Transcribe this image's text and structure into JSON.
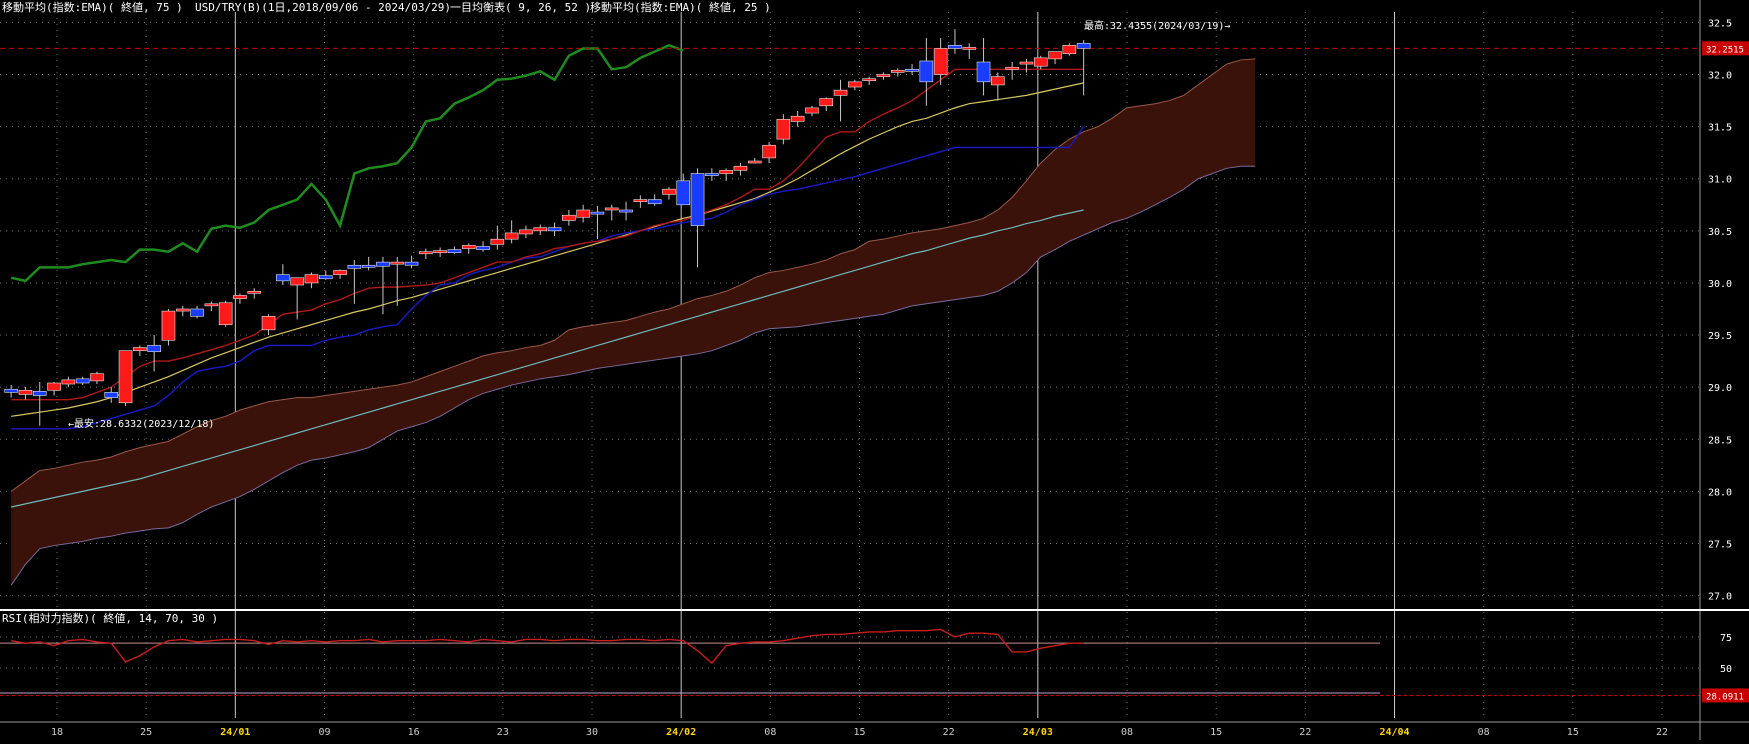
{
  "header": {
    "ema75_label": "移動平均(指数:EMA)( 終値, 75 )",
    "symbol_label": "USD/TRY(B)(1日,2018/09/06 - 2024/03/29)",
    "ichimoku_label": "一目均衡表( 9, 26, 52 )",
    "ema25_label": "移動平均(指数:EMA)( 終値, 25 )"
  },
  "colors": {
    "background": "#000000",
    "grid": "#6f6f6f",
    "separator": "#c8c8c8",
    "bull_candle": "#ff1a1a",
    "bear_candle": "#1a3cff",
    "tenkan": "#b01818",
    "kijun": "#1a1ac8",
    "chikou": "#1f8c1f",
    "senkou_a": "#9a5a4a",
    "senkou_b": "#7a6a9a",
    "cloud_fill": "#3a120a",
    "ema25": "#d9c860",
    "ema75": "#6fb8b8",
    "rsi_line": "#c81e1e",
    "price_marker": "#c80000"
  },
  "chart_data": [
    {
      "type": "candlestick",
      "ylim": [
        26.9,
        32.6
      ],
      "y_ticks": [
        "32.5",
        "32.0",
        "31.5",
        "31.0",
        "30.5",
        "30.0",
        "29.5",
        "29.0",
        "28.5",
        "28.0",
        "27.5",
        "27.0"
      ],
      "x_tick_labels": [
        "18",
        "25",
        "24/01",
        "09",
        "16",
        "23",
        "30",
        "24/02",
        "08",
        "15",
        "22",
        "24/03",
        "08",
        "15",
        "22",
        "24/04",
        "08",
        "15",
        "22"
      ],
      "x_tick_highlight": [
        "24/01",
        "24/02",
        "24/03",
        "24/04"
      ],
      "current_price": 32.2515,
      "current_price_label": "32.2515",
      "high_annotation": "最高:32.4355(2024/03/19)→",
      "low_annotation": "←最安:28.6332(2023/12/18)",
      "candles": [
        {
          "o": 28.98,
          "h": 29.02,
          "l": 28.9,
          "c": 28.95
        },
        {
          "o": 28.93,
          "h": 29.0,
          "l": 28.88,
          "c": 28.97
        },
        {
          "o": 28.96,
          "h": 29.05,
          "l": 28.63,
          "c": 28.92
        },
        {
          "o": 28.97,
          "h": 29.05,
          "l": 28.92,
          "c": 29.04
        },
        {
          "o": 29.03,
          "h": 29.1,
          "l": 29.0,
          "c": 29.07
        },
        {
          "o": 29.08,
          "h": 29.1,
          "l": 29.02,
          "c": 29.04
        },
        {
          "o": 29.06,
          "h": 29.15,
          "l": 29.03,
          "c": 29.13
        },
        {
          "o": 28.95,
          "h": 29.0,
          "l": 28.85,
          "c": 28.9
        },
        {
          "o": 28.85,
          "h": 29.35,
          "l": 28.82,
          "c": 29.35
        },
        {
          "o": 29.35,
          "h": 29.4,
          "l": 29.3,
          "c": 29.38
        },
        {
          "o": 29.4,
          "h": 29.5,
          "l": 29.15,
          "c": 29.34
        },
        {
          "o": 29.45,
          "h": 29.75,
          "l": 29.4,
          "c": 29.73
        },
        {
          "o": 29.73,
          "h": 29.78,
          "l": 29.68,
          "c": 29.75
        },
        {
          "o": 29.75,
          "h": 29.78,
          "l": 29.66,
          "c": 29.68
        },
        {
          "o": 29.78,
          "h": 29.82,
          "l": 29.73,
          "c": 29.8
        },
        {
          "o": 29.6,
          "h": 29.83,
          "l": 29.58,
          "c": 29.81
        },
        {
          "o": 29.85,
          "h": 29.9,
          "l": 29.8,
          "c": 29.88
        },
        {
          "o": 29.9,
          "h": 29.95,
          "l": 29.85,
          "c": 29.92
        },
        {
          "o": 29.55,
          "h": 29.7,
          "l": 29.5,
          "c": 29.68
        },
        {
          "o": 30.08,
          "h": 30.18,
          "l": 29.98,
          "c": 30.02
        },
        {
          "o": 29.98,
          "h": 30.05,
          "l": 29.65,
          "c": 30.05
        },
        {
          "o": 30.0,
          "h": 30.1,
          "l": 29.95,
          "c": 30.08
        },
        {
          "o": 30.07,
          "h": 30.12,
          "l": 30.03,
          "c": 30.04
        },
        {
          "o": 30.08,
          "h": 30.13,
          "l": 30.04,
          "c": 30.12
        },
        {
          "o": 30.17,
          "h": 30.22,
          "l": 29.8,
          "c": 30.14
        },
        {
          "o": 30.17,
          "h": 30.25,
          "l": 30.12,
          "c": 30.15
        },
        {
          "o": 30.2,
          "h": 30.25,
          "l": 29.7,
          "c": 30.16
        },
        {
          "o": 30.18,
          "h": 30.25,
          "l": 29.78,
          "c": 30.2
        },
        {
          "o": 30.2,
          "h": 30.26,
          "l": 30.14,
          "c": 30.17
        },
        {
          "o": 30.28,
          "h": 30.33,
          "l": 30.23,
          "c": 30.3
        },
        {
          "o": 30.29,
          "h": 30.34,
          "l": 30.25,
          "c": 30.31
        },
        {
          "o": 30.32,
          "h": 30.35,
          "l": 30.28,
          "c": 30.29
        },
        {
          "o": 30.33,
          "h": 30.38,
          "l": 30.28,
          "c": 30.36
        },
        {
          "o": 30.35,
          "h": 30.4,
          "l": 30.3,
          "c": 30.32
        },
        {
          "o": 30.37,
          "h": 30.55,
          "l": 30.32,
          "c": 30.42
        },
        {
          "o": 30.42,
          "h": 30.6,
          "l": 30.38,
          "c": 30.48
        },
        {
          "o": 30.47,
          "h": 30.55,
          "l": 30.43,
          "c": 30.51
        },
        {
          "o": 30.5,
          "h": 30.56,
          "l": 30.46,
          "c": 30.53
        },
        {
          "o": 30.53,
          "h": 30.58,
          "l": 30.45,
          "c": 30.5
        },
        {
          "o": 30.6,
          "h": 30.7,
          "l": 30.55,
          "c": 30.65
        },
        {
          "o": 30.63,
          "h": 30.75,
          "l": 30.58,
          "c": 30.7
        },
        {
          "o": 30.68,
          "h": 30.74,
          "l": 30.42,
          "c": 30.66
        },
        {
          "o": 30.7,
          "h": 30.75,
          "l": 30.6,
          "c": 30.72
        },
        {
          "o": 30.7,
          "h": 30.78,
          "l": 30.6,
          "c": 30.68
        },
        {
          "o": 30.78,
          "h": 30.84,
          "l": 30.72,
          "c": 30.8
        },
        {
          "o": 30.8,
          "h": 30.85,
          "l": 30.74,
          "c": 30.76
        },
        {
          "o": 30.85,
          "h": 30.92,
          "l": 30.8,
          "c": 30.9
        },
        {
          "o": 30.98,
          "h": 31.05,
          "l": 30.78,
          "c": 30.75
        },
        {
          "o": 31.05,
          "h": 31.1,
          "l": 30.15,
          "c": 30.55
        },
        {
          "o": 31.05,
          "h": 31.1,
          "l": 30.98,
          "c": 31.03
        },
        {
          "o": 31.05,
          "h": 31.1,
          "l": 30.98,
          "c": 31.08
        },
        {
          "o": 31.08,
          "h": 31.15,
          "l": 31.03,
          "c": 31.12
        },
        {
          "o": 31.17,
          "h": 31.2,
          "l": 31.15,
          "c": 31.17
        },
        {
          "o": 31.2,
          "h": 31.35,
          "l": 31.15,
          "c": 31.32
        },
        {
          "o": 31.38,
          "h": 31.62,
          "l": 31.33,
          "c": 31.57
        },
        {
          "o": 31.55,
          "h": 31.65,
          "l": 31.5,
          "c": 31.6
        },
        {
          "o": 31.63,
          "h": 31.7,
          "l": 31.6,
          "c": 31.68
        },
        {
          "o": 31.7,
          "h": 31.78,
          "l": 31.65,
          "c": 31.77
        },
        {
          "o": 31.8,
          "h": 31.95,
          "l": 31.55,
          "c": 31.85
        },
        {
          "o": 31.88,
          "h": 31.95,
          "l": 31.85,
          "c": 31.93
        },
        {
          "o": 31.95,
          "h": 31.98,
          "l": 31.9,
          "c": 31.96
        },
        {
          "o": 31.98,
          "h": 32.02,
          "l": 31.95,
          "c": 32.0
        },
        {
          "o": 32.02,
          "h": 32.06,
          "l": 31.98,
          "c": 32.04
        },
        {
          "o": 32.05,
          "h": 32.1,
          "l": 32.0,
          "c": 32.03
        },
        {
          "o": 32.13,
          "h": 32.35,
          "l": 31.7,
          "c": 31.93
        },
        {
          "o": 32.0,
          "h": 32.35,
          "l": 31.9,
          "c": 32.25
        },
        {
          "o": 32.28,
          "h": 32.4355,
          "l": 32.2,
          "c": 32.25
        },
        {
          "o": 32.25,
          "h": 32.3,
          "l": 32.15,
          "c": 32.26
        },
        {
          "o": 32.12,
          "h": 32.35,
          "l": 31.8,
          "c": 31.93
        },
        {
          "o": 31.9,
          "h": 32.02,
          "l": 31.75,
          "c": 31.98
        },
        {
          "o": 32.05,
          "h": 32.12,
          "l": 31.95,
          "c": 32.07
        },
        {
          "o": 32.1,
          "h": 32.15,
          "l": 32.02,
          "c": 32.12
        },
        {
          "o": 32.08,
          "h": 32.18,
          "l": 32.05,
          "c": 32.16
        },
        {
          "o": 32.15,
          "h": 32.2,
          "l": 32.1,
          "c": 32.22
        },
        {
          "o": 32.2,
          "h": 32.3,
          "l": 32.18,
          "c": 32.28
        },
        {
          "o": 32.3,
          "h": 32.33,
          "l": 31.8,
          "c": 32.2515
        }
      ],
      "ema25": [
        28.72,
        28.74,
        28.76,
        28.78,
        28.8,
        28.83,
        28.86,
        28.9,
        28.95,
        29.0,
        29.05,
        29.1,
        29.16,
        29.22,
        29.28,
        29.33,
        29.38,
        29.43,
        29.48,
        29.52,
        29.56,
        29.6,
        29.64,
        29.68,
        29.72,
        29.75,
        29.79,
        29.83,
        29.86,
        29.9,
        29.94,
        29.98,
        30.02,
        30.06,
        30.1,
        30.14,
        30.18,
        30.22,
        30.26,
        30.3,
        30.34,
        30.38,
        30.42,
        30.46,
        30.5,
        30.54,
        30.58,
        30.62,
        30.65,
        30.69,
        30.73,
        30.77,
        30.81,
        30.87,
        30.93,
        31.0,
        31.08,
        31.16,
        31.24,
        31.31,
        31.38,
        31.44,
        31.5,
        31.55,
        31.58,
        31.63,
        31.68,
        31.72,
        31.74,
        31.76,
        31.78,
        31.8,
        31.83,
        31.86,
        31.89,
        31.92
      ],
      "ema75": [
        27.85,
        27.88,
        27.91,
        27.94,
        27.97,
        28.0,
        28.03,
        28.06,
        28.09,
        28.12,
        28.16,
        28.2,
        28.24,
        28.28,
        28.32,
        28.36,
        28.4,
        28.44,
        28.48,
        28.52,
        28.56,
        28.6,
        28.64,
        28.68,
        28.72,
        28.76,
        28.8,
        28.84,
        28.88,
        28.92,
        28.96,
        29.0,
        29.04,
        29.08,
        29.12,
        29.16,
        29.2,
        29.24,
        29.28,
        29.32,
        29.36,
        29.4,
        29.44,
        29.48,
        29.52,
        29.56,
        29.6,
        29.64,
        29.68,
        29.72,
        29.76,
        29.8,
        29.84,
        29.88,
        29.92,
        29.96,
        30.0,
        30.04,
        30.08,
        30.12,
        30.16,
        30.2,
        30.24,
        30.28,
        30.31,
        30.35,
        30.39,
        30.43,
        30.46,
        30.5,
        30.53,
        30.57,
        30.6,
        30.64,
        30.67,
        30.7
      ],
      "tenkan": [
        28.88,
        28.88,
        28.88,
        28.88,
        28.88,
        28.9,
        28.95,
        29.0,
        29.1,
        29.2,
        29.25,
        29.25,
        29.28,
        29.32,
        29.36,
        29.4,
        29.45,
        29.5,
        29.6,
        29.7,
        29.72,
        29.74,
        29.8,
        29.84,
        29.9,
        29.95,
        29.96,
        29.96,
        29.97,
        29.98,
        30.0,
        30.05,
        30.1,
        30.15,
        30.2,
        30.2,
        30.25,
        30.28,
        30.33,
        30.35,
        30.38,
        30.4,
        30.42,
        30.45,
        30.5,
        30.55,
        30.58,
        30.6,
        30.65,
        30.7,
        30.75,
        30.82,
        30.9,
        30.9,
        30.98,
        31.1,
        31.25,
        31.4,
        31.45,
        31.45,
        31.55,
        31.62,
        31.68,
        31.75,
        31.85,
        31.95,
        32.05,
        32.05,
        32.05,
        32.05,
        32.05,
        32.05,
        32.05,
        32.05,
        32.05,
        32.05
      ],
      "kijun": [
        28.6,
        28.6,
        28.6,
        28.6,
        28.6,
        28.62,
        28.66,
        28.7,
        28.74,
        28.78,
        28.82,
        28.92,
        29.05,
        29.15,
        29.18,
        29.2,
        29.25,
        29.35,
        29.4,
        29.4,
        29.4,
        29.4,
        29.45,
        29.48,
        29.5,
        29.55,
        29.58,
        29.6,
        29.75,
        29.88,
        29.98,
        30.0,
        30.08,
        30.12,
        30.15,
        30.2,
        30.24,
        30.25,
        30.3,
        30.35,
        30.38,
        30.4,
        30.45,
        30.48,
        30.5,
        30.52,
        30.55,
        30.58,
        30.6,
        30.62,
        30.68,
        30.75,
        30.8,
        30.85,
        30.88,
        30.9,
        30.93,
        30.96,
        30.99,
        31.02,
        31.06,
        31.1,
        31.14,
        31.18,
        31.22,
        31.26,
        31.3,
        31.3,
        31.3,
        31.3,
        31.3,
        31.3,
        31.3,
        31.3,
        31.3,
        31.5
      ],
      "senkou_a": [
        28.0,
        28.1,
        28.2,
        28.22,
        28.25,
        28.28,
        28.3,
        28.33,
        28.38,
        28.42,
        28.45,
        28.48,
        28.55,
        28.62,
        28.68,
        28.72,
        28.78,
        28.82,
        28.86,
        28.88,
        28.9,
        28.9,
        28.92,
        28.94,
        28.96,
        28.98,
        29.0,
        29.02,
        29.05,
        29.1,
        29.15,
        29.2,
        29.25,
        29.3,
        29.33,
        29.35,
        29.38,
        29.4,
        29.45,
        29.55,
        29.58,
        29.6,
        29.62,
        29.64,
        29.68,
        29.72,
        29.75,
        29.8,
        29.85,
        29.88,
        29.92,
        29.98,
        30.05,
        30.1,
        30.12,
        30.15,
        30.18,
        30.22,
        30.28,
        30.32,
        30.4,
        30.42,
        30.45,
        30.48,
        30.5,
        30.52,
        30.55,
        30.58,
        30.62,
        30.7,
        30.82,
        30.98,
        31.15,
        31.28,
        31.38,
        31.45,
        31.5,
        31.58,
        31.68,
        31.7,
        31.72,
        31.75,
        31.8,
        31.9,
        32.0,
        32.1,
        32.14,
        32.15
      ],
      "senkou_b": [
        27.1,
        27.3,
        27.45,
        27.48,
        27.5,
        27.52,
        27.55,
        27.57,
        27.6,
        27.62,
        27.64,
        27.65,
        27.7,
        27.78,
        27.85,
        27.9,
        27.95,
        28.02,
        28.1,
        28.18,
        28.25,
        28.3,
        28.32,
        28.35,
        28.38,
        28.42,
        28.5,
        28.58,
        28.62,
        28.66,
        28.72,
        28.8,
        28.88,
        28.94,
        28.98,
        29.02,
        29.05,
        29.08,
        29.1,
        29.12,
        29.15,
        29.18,
        29.2,
        29.22,
        29.24,
        29.26,
        29.28,
        29.3,
        29.32,
        29.35,
        29.4,
        29.45,
        29.52,
        29.56,
        29.57,
        29.58,
        29.6,
        29.62,
        29.64,
        29.66,
        29.68,
        29.7,
        29.74,
        29.78,
        29.8,
        29.82,
        29.84,
        29.86,
        29.88,
        29.92,
        30.0,
        30.1,
        30.25,
        30.32,
        30.4,
        30.46,
        30.52,
        30.58,
        30.62,
        30.68,
        30.75,
        30.82,
        30.9,
        31.0,
        31.05,
        31.1,
        31.12,
        31.12
      ],
      "chikou": [
        30.05,
        30.02,
        30.15,
        30.15,
        30.15,
        30.18,
        30.2,
        30.22,
        30.2,
        30.32,
        30.32,
        30.3,
        30.38,
        30.3,
        30.52,
        30.55,
        30.53,
        30.58,
        30.7,
        30.75,
        30.8,
        30.95,
        30.8,
        30.55,
        31.05,
        31.1,
        31.12,
        31.15,
        31.3,
        31.55,
        31.58,
        31.72,
        31.78,
        31.85,
        31.95,
        31.96,
        31.99,
        32.03,
        31.95,
        32.18,
        32.25,
        32.25,
        32.05,
        32.07,
        32.16,
        32.22,
        32.28,
        32.23
      ]
    },
    {
      "type": "line",
      "title": "RSI(相対力指数)( 終値, 14, 70, 30 )",
      "ylim": [
        10,
        95
      ],
      "y_ticks": [
        "75",
        "50"
      ],
      "reference_levels": [
        70,
        30
      ],
      "current_value": 28.0911,
      "current_value_label": "28.0911",
      "values": [
        72,
        70,
        71,
        68,
        72,
        73,
        71,
        70,
        55,
        60,
        67,
        72,
        73,
        71,
        72,
        73,
        73,
        72,
        69,
        72,
        71,
        72,
        71,
        72,
        72,
        73,
        71,
        72,
        72,
        72,
        73,
        72,
        71,
        73,
        72,
        71,
        73,
        73,
        72,
        73,
        73,
        72,
        72,
        73,
        73,
        72,
        73,
        72,
        64,
        54,
        68,
        70,
        71,
        71,
        72,
        74,
        76,
        77,
        77,
        78,
        79,
        79,
        80,
        80,
        80,
        81,
        75,
        78,
        78,
        77,
        63,
        63,
        66,
        68,
        70,
        70
      ]
    }
  ]
}
